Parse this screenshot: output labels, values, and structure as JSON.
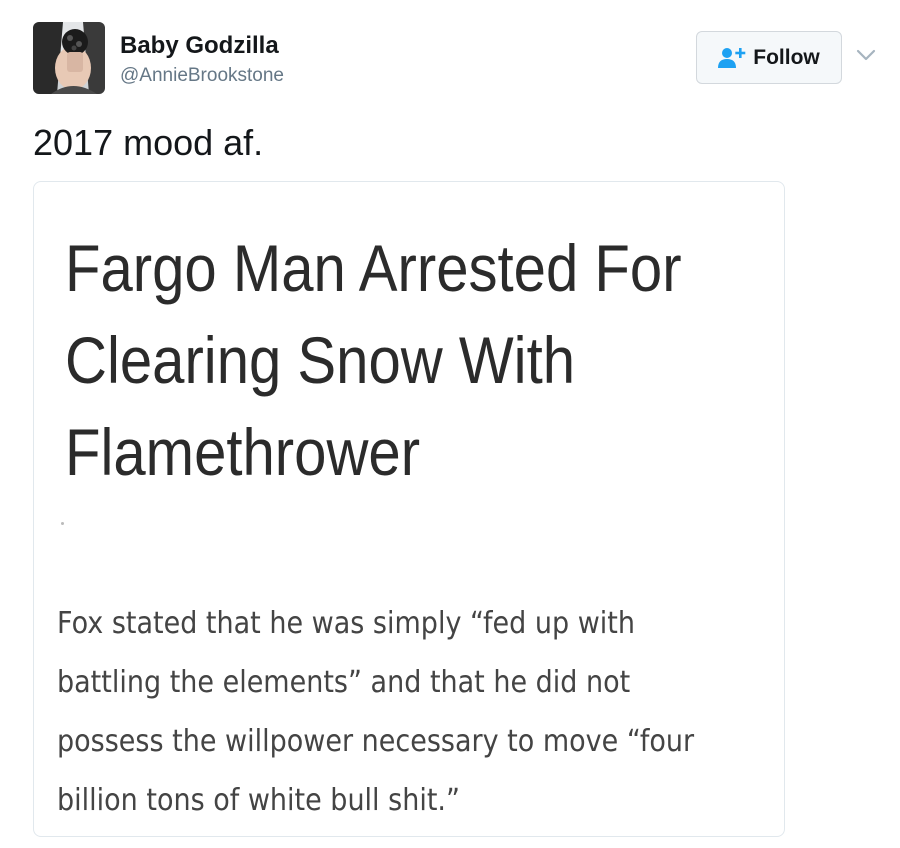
{
  "user": {
    "display_name": "Baby Godzilla",
    "screen_name": "@AnnieBrookstone",
    "avatar_icon": "profile-photo"
  },
  "actions": {
    "follow_label": "Follow",
    "follow_icon": "add-user-icon",
    "menu_icon": "chevron-down-icon"
  },
  "tweet": {
    "text": "2017 mood af."
  },
  "media": {
    "headline_lines": [
      "Fargo Man Arrested For",
      "Clearing Snow With",
      "Flamethrower"
    ],
    "body_lines": [
      "Fox stated that he was simply “fed up with",
      "battling the elements” and that he did not",
      "possess the willpower necessary to move “four",
      "billion tons of white bull shit.”"
    ]
  },
  "colors": {
    "accent": "#1da1f2",
    "text_primary": "#14171a",
    "text_secondary": "#657786",
    "button_bg": "#f5f8fa",
    "card_border": "#e1e8ed"
  }
}
